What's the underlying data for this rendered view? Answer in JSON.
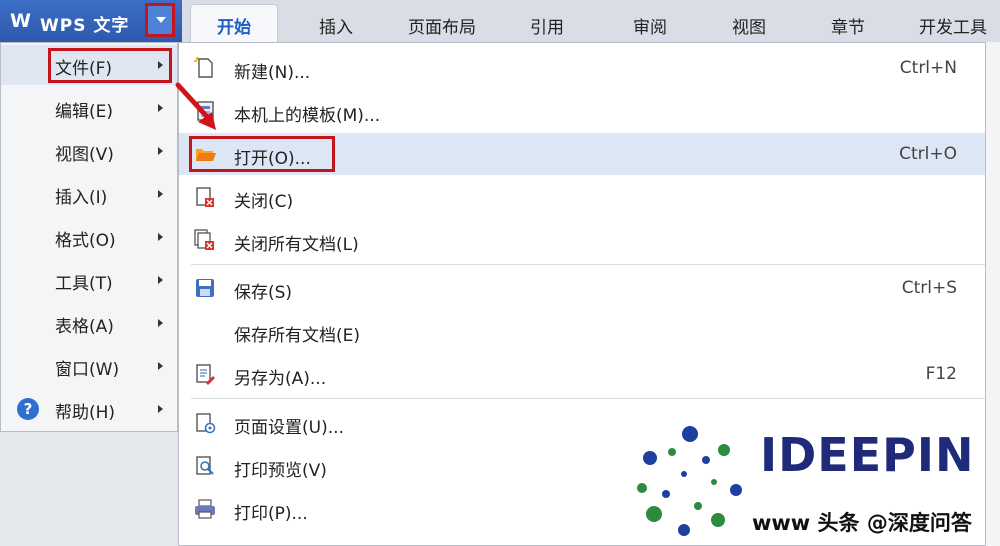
{
  "app": {
    "logo_glyph": "W",
    "title": "WPS 文字",
    "brand_color": "#2c59ad",
    "accent_red": "#c3161c"
  },
  "ribbon_tabs": [
    "开始",
    "插入",
    "页面布局",
    "引用",
    "审阅",
    "视图",
    "章节",
    "开发工具"
  ],
  "main_menu": [
    {
      "label": "文件(F)"
    },
    {
      "label": "编辑(E)"
    },
    {
      "label": "视图(V)"
    },
    {
      "label": "插入(I)"
    },
    {
      "label": "格式(O)"
    },
    {
      "label": "工具(T)"
    },
    {
      "label": "表格(A)"
    },
    {
      "label": "窗口(W)"
    },
    {
      "label": "帮助(H)",
      "icon": "help-icon"
    }
  ],
  "file_menu": [
    {
      "label": "新建(N)...",
      "shortcut": "Ctrl+N",
      "icon": "new-document-icon"
    },
    {
      "label": "本机上的模板(M)...",
      "shortcut": "",
      "icon": "template-icon"
    },
    {
      "label": "打开(O)...",
      "shortcut": "Ctrl+O",
      "icon": "open-folder-icon"
    },
    {
      "label": "关闭(C)",
      "shortcut": "",
      "icon": "close-document-icon"
    },
    {
      "label": "关闭所有文档(L)",
      "shortcut": "",
      "icon": "close-all-documents-icon"
    },
    {
      "label": "保存(S)",
      "shortcut": "Ctrl+S",
      "icon": "save-icon"
    },
    {
      "label": "保存所有文档(E)",
      "shortcut": "",
      "icon": ""
    },
    {
      "label": "另存为(A)...",
      "shortcut": "F12",
      "icon": "save-as-icon"
    },
    {
      "label": "页面设置(U)...",
      "shortcut": "",
      "icon": "page-setup-icon"
    },
    {
      "label": "打印预览(V)",
      "shortcut": "",
      "icon": "print-preview-icon"
    },
    {
      "label": "打印(P)...",
      "shortcut": "",
      "icon": "printer-icon"
    }
  ],
  "watermark": {
    "logo_text": "IDEEPIN",
    "logo_subtitle": "",
    "caption": "www 头条 @深度问答"
  }
}
